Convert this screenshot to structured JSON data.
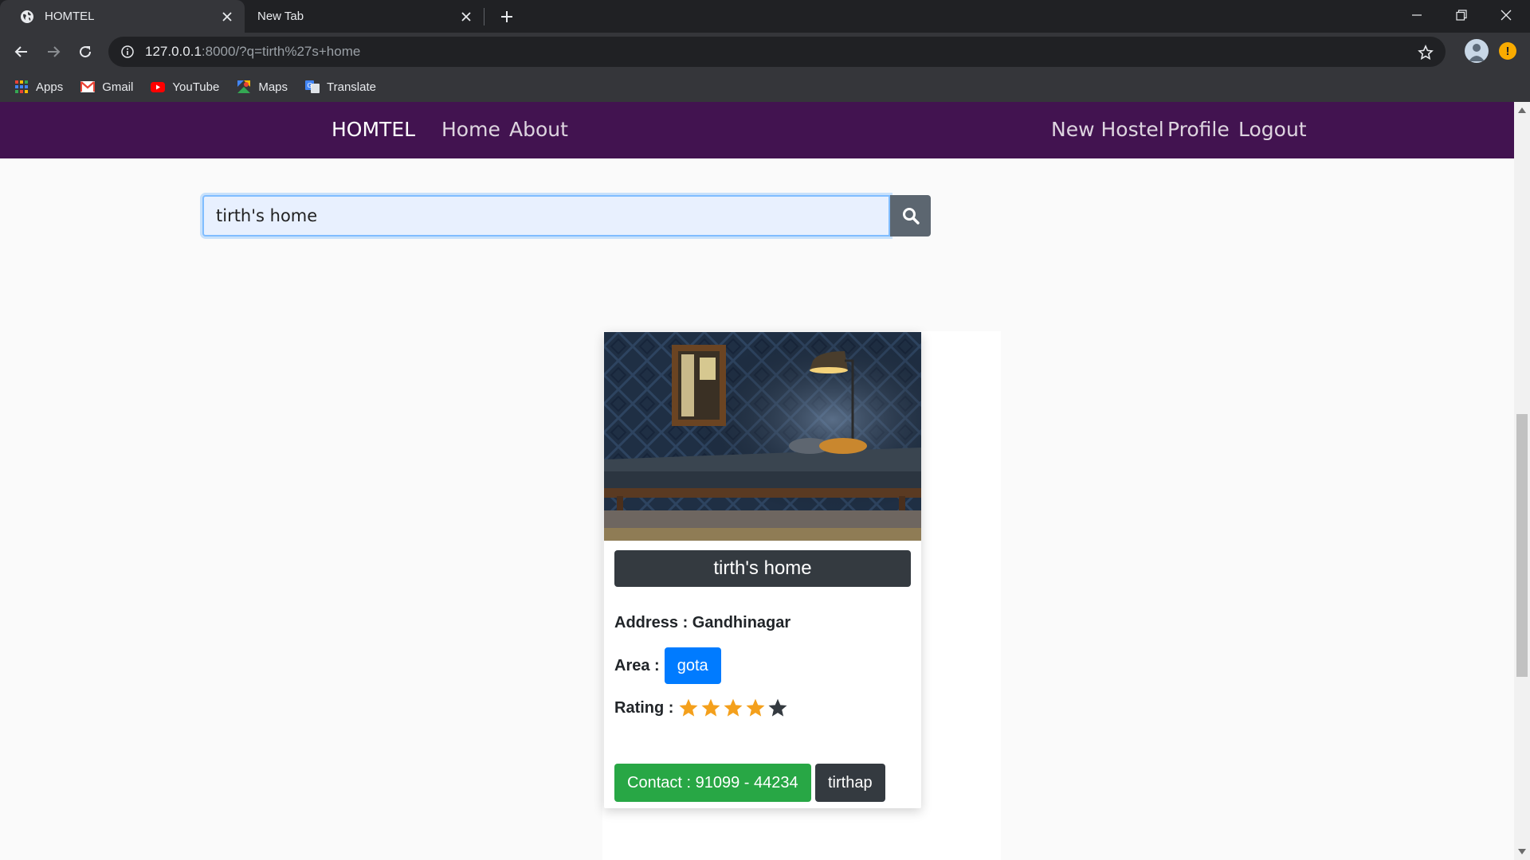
{
  "browser": {
    "tabs": [
      {
        "title": "HOMTEL",
        "active": true
      },
      {
        "title": "New Tab",
        "active": false
      }
    ],
    "url_host": "127.0.0.1",
    "url_rest": ":8000/?q=tirth%27s+home",
    "bookmarks": [
      {
        "label": "Apps",
        "icon": "apps-grid-icon"
      },
      {
        "label": "Gmail",
        "icon": "gmail-icon"
      },
      {
        "label": "YouTube",
        "icon": "youtube-icon"
      },
      {
        "label": "Maps",
        "icon": "maps-icon"
      },
      {
        "label": "Translate",
        "icon": "translate-icon"
      }
    ],
    "alert_glyph": "!"
  },
  "site": {
    "brand": "HOMTEL",
    "nav_left": [
      "Home",
      "About"
    ],
    "nav_right": [
      "New Hostel",
      "Profile",
      "Logout"
    ],
    "colors": {
      "navbar": "#421350",
      "title_bg": "#343a40",
      "badge": "#007bff",
      "contact": "#28a745",
      "star_filled": "#f4a01c",
      "star_empty": "#343a40"
    }
  },
  "search": {
    "value": "tirth's home",
    "button_icon": "search-icon"
  },
  "card": {
    "title": "tirth's home",
    "address_label": "Address : Gandhinagar",
    "area_label": "Area :",
    "area_value": "gota",
    "rating_label": "Rating :",
    "rating": 4,
    "rating_max": 5,
    "contact": "Contact : 91099 - 44234",
    "owner": "tirthap"
  }
}
